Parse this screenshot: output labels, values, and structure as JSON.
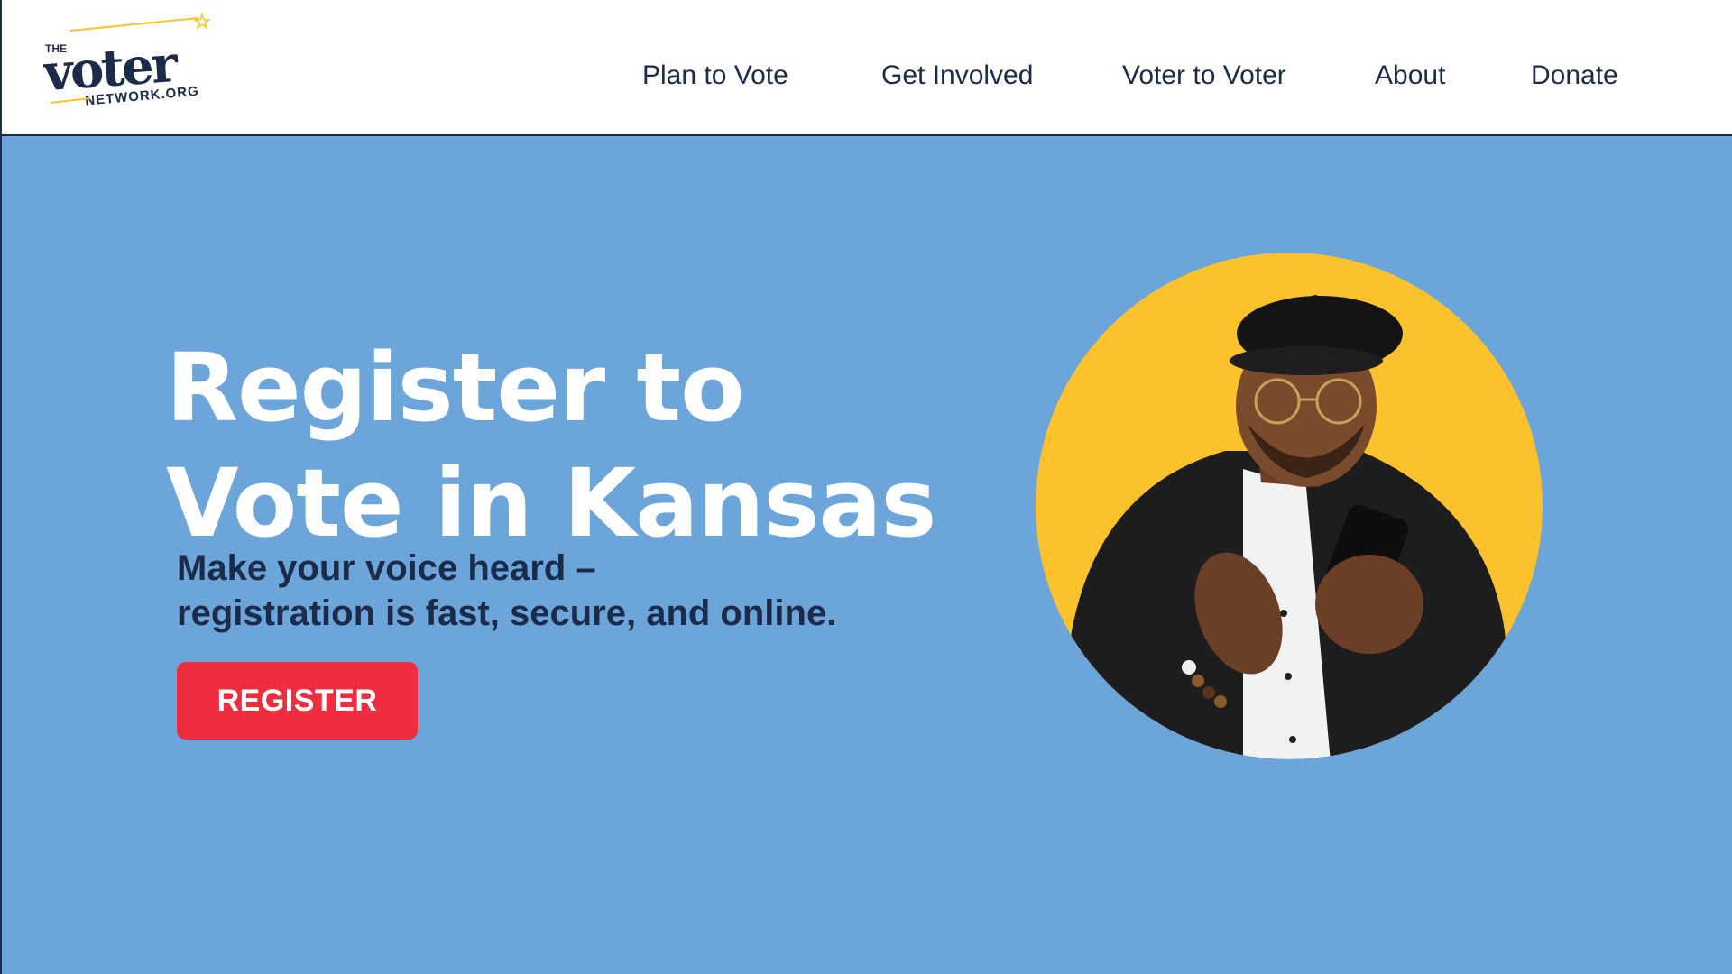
{
  "header": {
    "logo": {
      "line_the": "THE",
      "line_voter": "voter",
      "line_network": "NETWORK.ORG"
    },
    "nav": [
      {
        "label": "Plan to Vote"
      },
      {
        "label": "Get Involved"
      },
      {
        "label": "Voter to Voter"
      },
      {
        "label": "About"
      },
      {
        "label": "Donate"
      }
    ]
  },
  "hero": {
    "title_line1": "Register to",
    "title_line2": "Vote in Kansas",
    "subtitle_line1": "Make your voice heard –",
    "subtitle_line2": "registration is fast, secure, and online.",
    "cta_label": "REGISTER",
    "image": "person-using-smartphone-photo"
  },
  "colors": {
    "background": "#6ba5da",
    "navy": "#1c2b4a",
    "cta": "#ee2e3e",
    "accent_yellow": "#fcc22d",
    "white": "#ffffff"
  }
}
